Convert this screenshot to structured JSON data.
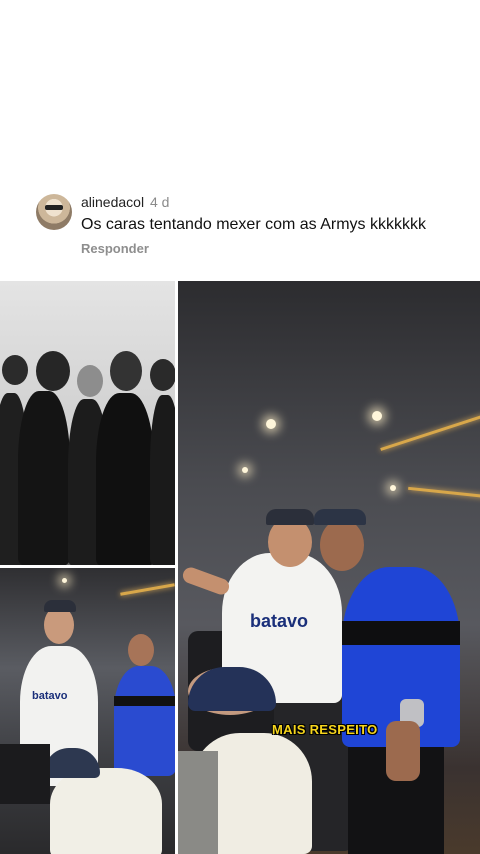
{
  "comment": {
    "username": "alinedacol",
    "time": "4 d",
    "text": "Os caras tentando mexer com as Armys kkkkkkk",
    "reply_label": "Responder"
  },
  "collage": {
    "caption": "MAIS RESPEITO",
    "shirt_brand": "batavo"
  }
}
